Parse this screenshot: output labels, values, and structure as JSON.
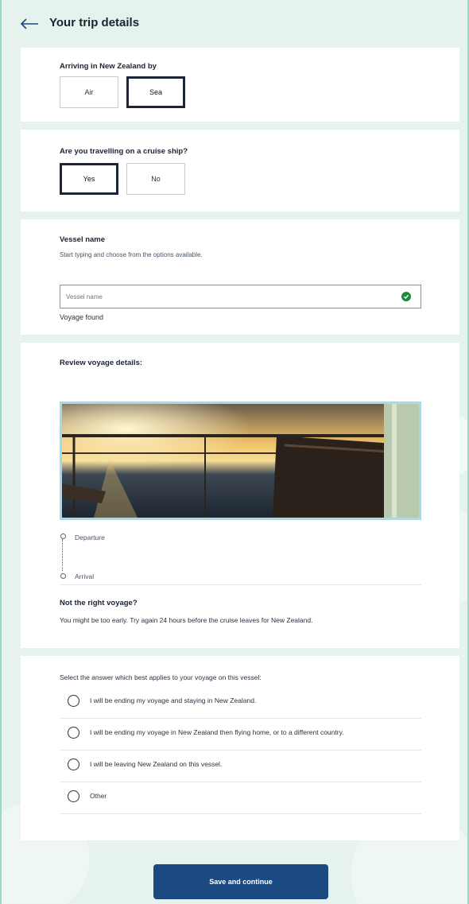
{
  "header": {
    "title": "Your trip details",
    "back_icon": "arrow-left-icon"
  },
  "arrival": {
    "question": "Arriving in New Zealand by",
    "options": [
      {
        "label": "Air",
        "selected": false
      },
      {
        "label": "Sea",
        "selected": true
      }
    ]
  },
  "cruise": {
    "question": "Are you travelling on a cruise ship?",
    "options": [
      {
        "label": "Yes",
        "selected": true
      },
      {
        "label": "No",
        "selected": false
      }
    ]
  },
  "vessel": {
    "label": "Vessel name",
    "hint": "Start typing and choose from the options available.",
    "placeholder": "Vessel name",
    "value": "",
    "status_icon": "check-circle-icon",
    "status_text": "Voyage found"
  },
  "review": {
    "title": "Review voyage details:",
    "departure_label": "Departure",
    "arrival_label": "Arrival",
    "not_right_title": "Not the right voyage?",
    "not_right_text": "You might be too early. Try again 24 hours before the cruise leaves for New Zealand."
  },
  "voyage_answer": {
    "question": "Select the answer which best applies to your voyage on this vessel:",
    "options": [
      {
        "label": "I will be ending my voyage and staying in New Zealand.",
        "selected": false
      },
      {
        "label": "I will be ending my voyage in New Zealand then flying home, or to a different country.",
        "selected": false
      },
      {
        "label": "I will be leaving New Zealand on this vessel.",
        "selected": false
      },
      {
        "label": "Other",
        "selected": false
      }
    ]
  },
  "actions": {
    "save_label": "Save and continue"
  },
  "colors": {
    "accent": "#1b4a80",
    "success": "#1f8a3d",
    "selected_border": "#1c2637",
    "page_bg": "#e6f2ed"
  }
}
